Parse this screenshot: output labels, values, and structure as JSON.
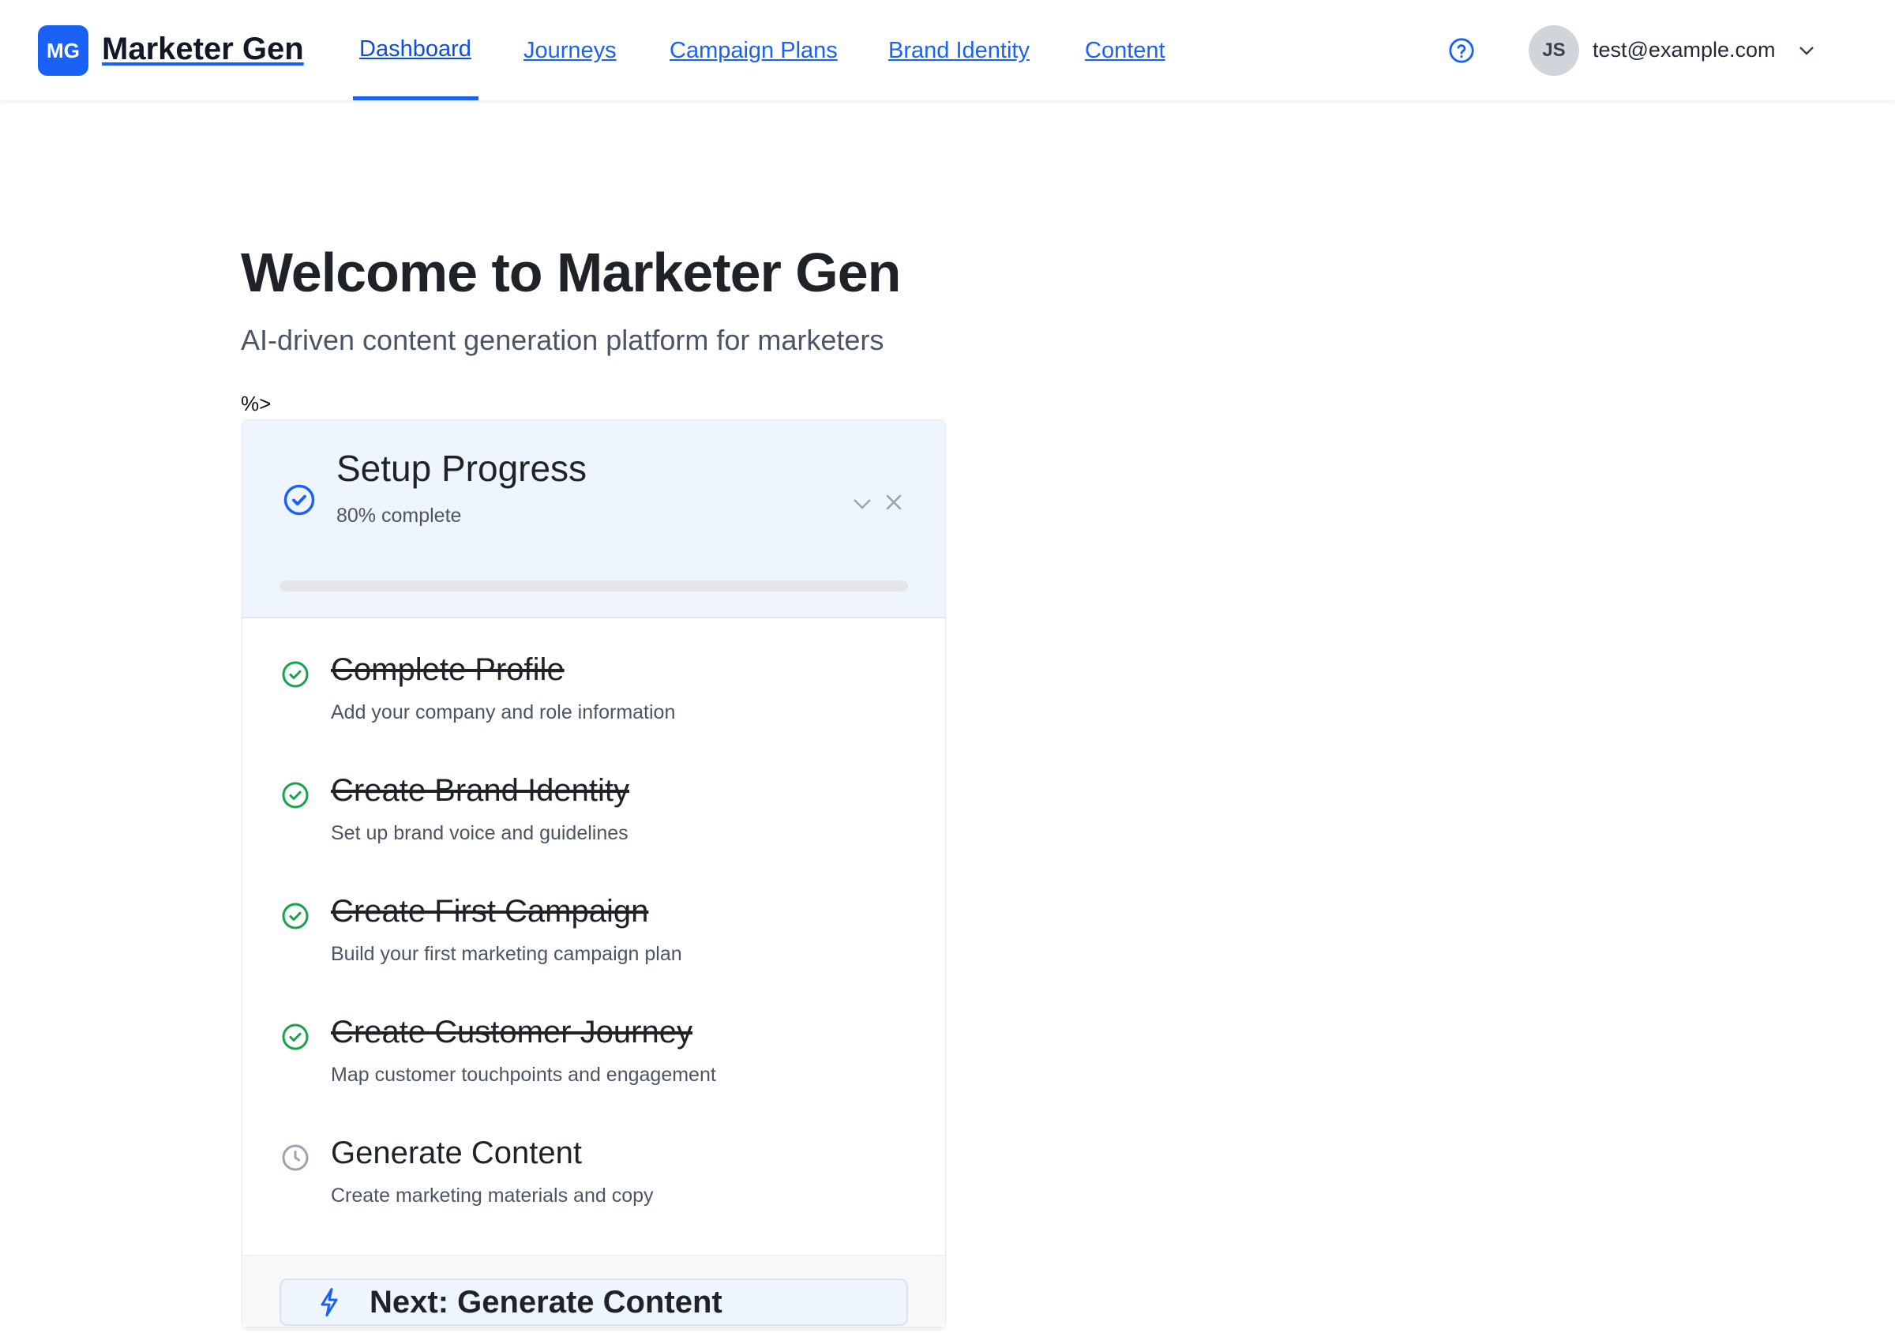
{
  "header": {
    "logo_initials": "MG",
    "brand": "Marketer Gen",
    "nav": [
      {
        "label": "Dashboard",
        "active": true
      },
      {
        "label": "Journeys"
      },
      {
        "label": "Campaign Plans"
      },
      {
        "label": "Brand Identity"
      },
      {
        "label": "Content"
      }
    ],
    "user_initials": "JS",
    "user_email": "test@example.com"
  },
  "main": {
    "title": "Welcome to Marketer Gen",
    "subtitle": "AI-driven content generation platform for marketers",
    "stray_text": "%>"
  },
  "setup": {
    "title": "Setup Progress",
    "progress_label": "80% complete",
    "progress_bar_fill_percent": 0,
    "steps": [
      {
        "title": "Complete Profile",
        "desc": "Add your company and role information",
        "done": true
      },
      {
        "title": "Create Brand Identity",
        "desc": "Set up brand voice and guidelines",
        "done": true
      },
      {
        "title": "Create First Campaign",
        "desc": "Build your first marketing campaign plan",
        "done": true
      },
      {
        "title": "Create Customer Journey",
        "desc": "Map customer touchpoints and engagement",
        "done": true
      },
      {
        "title": "Generate Content",
        "desc": "Create marketing materials and copy",
        "done": false
      }
    ],
    "next_label": "Next: Generate Content"
  },
  "colors": {
    "accent": "#1a62f5",
    "success": "#16a34a",
    "pending": "#9ca3af"
  }
}
